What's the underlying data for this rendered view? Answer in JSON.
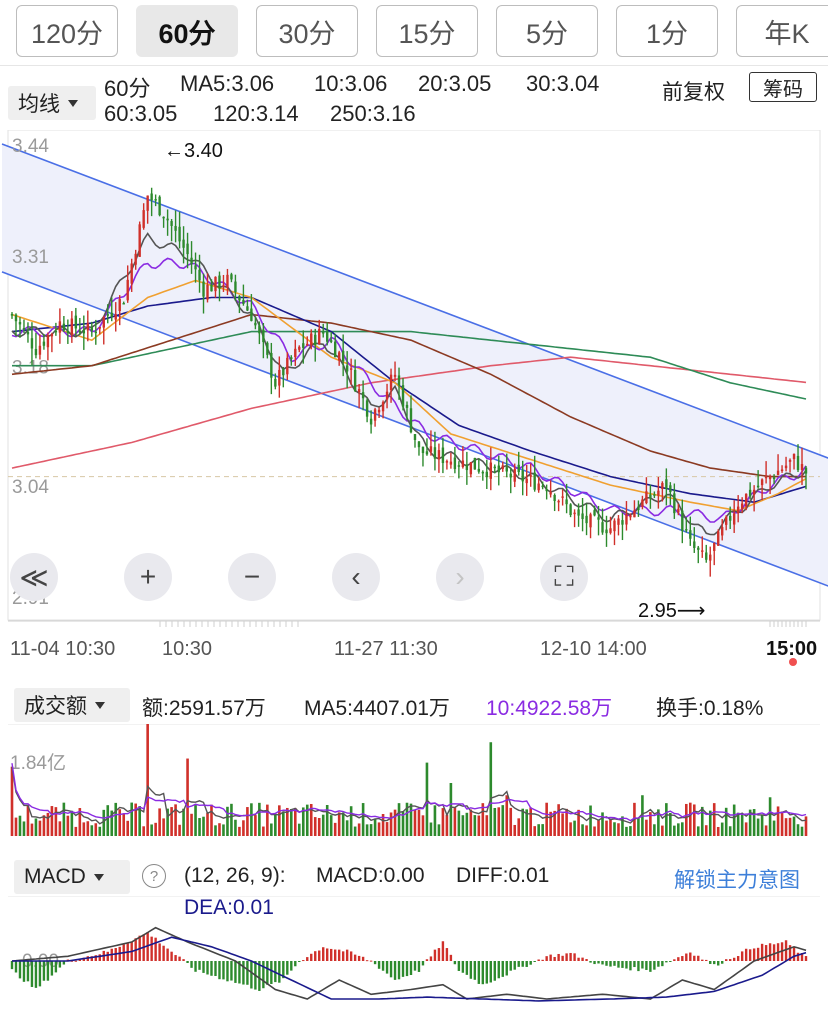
{
  "tabs": [
    "120分",
    "60分",
    "30分",
    "15分",
    "5分",
    "1分",
    "年K"
  ],
  "active_tab": 1,
  "ma_header": {
    "selector": "均线",
    "period": "60分",
    "ma5": "MA5:3.06",
    "ma10": "10:3.06",
    "ma20": "20:3.05",
    "ma30": "30:3.04",
    "ma60": "60:3.05",
    "ma120": "120:3.14",
    "ma250": "250:3.16",
    "adjust": "前复权",
    "chips": "筹码"
  },
  "colors": {
    "up": "#d0302a",
    "down": "#2d8a2d",
    "ma5": "#555555",
    "ma10": "#8a2be2",
    "ma20": "#f0a030",
    "ma30": "#1a1a8c",
    "ma60": "#8b3a22",
    "ma120": "#2e8b57",
    "ma250": "#e05a6a",
    "channel": "#4a6fe6",
    "channel_fill": "#eef0fb",
    "link": "#3d7fd9"
  },
  "controls": [
    {
      "icon": "rewind-icon",
      "symbol": "≪",
      "dim": false
    },
    {
      "icon": "zoom-in-icon",
      "symbol": "+",
      "dim": false
    },
    {
      "icon": "zoom-out-icon",
      "symbol": "−",
      "dim": false
    },
    {
      "icon": "prev-icon",
      "symbol": "‹",
      "dim": false
    },
    {
      "icon": "next-icon",
      "symbol": "›",
      "dim": true
    },
    {
      "icon": "fullscreen-icon",
      "symbol": "⛶",
      "dim": false
    }
  ],
  "volume_header": {
    "selector": "成交额",
    "amount": "额:2591.57万",
    "ma5": "MA5:4407.01万",
    "ma10": "10:4922.58万",
    "turnover": "换手:0.18%"
  },
  "macd_header": {
    "selector": "MACD",
    "help": "?",
    "params": "(12, 26, 9):",
    "macd": "MACD:0.00",
    "diff": "DIFF:0.01",
    "dea": "DEA:0.01",
    "unlock": "解锁主力意图"
  },
  "chart_data": [
    {
      "type": "candlestick",
      "ylim": [
        2.91,
        3.44
      ],
      "y_ticks": [
        "3.44",
        "3.31",
        "3.18",
        "3.04",
        "2.91"
      ],
      "x_ticks": [
        "11-04 10:30",
        "10:30",
        "11-27 11:30",
        "12-10 14:00",
        "15:00"
      ],
      "annotations": {
        "high": "←3.40",
        "low": "2.95⟶"
      },
      "last_price": 3.05,
      "close_anchors": [
        [
          0,
          3.24
        ],
        [
          6,
          3.2
        ],
        [
          12,
          3.23
        ],
        [
          20,
          3.22
        ],
        [
          28,
          3.26
        ],
        [
          34,
          3.38
        ],
        [
          38,
          3.36
        ],
        [
          44,
          3.31
        ],
        [
          48,
          3.27
        ],
        [
          54,
          3.28
        ],
        [
          60,
          3.24
        ],
        [
          66,
          3.16
        ],
        [
          72,
          3.2
        ],
        [
          78,
          3.22
        ],
        [
          84,
          3.18
        ],
        [
          90,
          3.12
        ],
        [
          96,
          3.17
        ],
        [
          102,
          3.08
        ],
        [
          110,
          3.07
        ],
        [
          118,
          3.06
        ],
        [
          126,
          3.05
        ],
        [
          134,
          3.04
        ],
        [
          142,
          3.0
        ],
        [
          150,
          2.99
        ],
        [
          158,
          3.02
        ],
        [
          164,
          3.04
        ],
        [
          170,
          2.97
        ],
        [
          174,
          2.95
        ],
        [
          182,
          3.02
        ],
        [
          190,
          3.05
        ],
        [
          196,
          3.07
        ],
        [
          200,
          3.05
        ]
      ],
      "ma_anchors": {
        "ma5": [
          [
            0,
            3.22
          ],
          [
            20,
            3.22
          ],
          [
            34,
            3.33
          ],
          [
            44,
            3.31
          ],
          [
            60,
            3.24
          ],
          [
            68,
            3.17
          ],
          [
            78,
            3.21
          ],
          [
            90,
            3.13
          ],
          [
            96,
            3.15
          ],
          [
            104,
            3.08
          ],
          [
            130,
            3.05
          ],
          [
            150,
            3.0
          ],
          [
            164,
            3.03
          ],
          [
            174,
            2.98
          ],
          [
            190,
            3.04
          ],
          [
            200,
            3.06
          ]
        ],
        "ma10": [
          [
            0,
            3.22
          ],
          [
            20,
            3.22
          ],
          [
            34,
            3.3
          ],
          [
            44,
            3.3
          ],
          [
            60,
            3.25
          ],
          [
            70,
            3.19
          ],
          [
            80,
            3.21
          ],
          [
            92,
            3.15
          ],
          [
            104,
            3.1
          ],
          [
            130,
            3.06
          ],
          [
            150,
            3.01
          ],
          [
            166,
            3.01
          ],
          [
            178,
            3.0
          ],
          [
            190,
            3.04
          ],
          [
            200,
            3.06
          ]
        ],
        "ma20": [
          [
            0,
            3.24
          ],
          [
            20,
            3.21
          ],
          [
            34,
            3.26
          ],
          [
            46,
            3.28
          ],
          [
            60,
            3.26
          ],
          [
            80,
            3.19
          ],
          [
            96,
            3.16
          ],
          [
            110,
            3.1
          ],
          [
            130,
            3.07
          ],
          [
            150,
            3.04
          ],
          [
            170,
            3.02
          ],
          [
            182,
            3.01
          ],
          [
            192,
            3.03
          ],
          [
            200,
            3.05
          ]
        ],
        "ma30": [
          [
            0,
            3.22
          ],
          [
            20,
            3.23
          ],
          [
            34,
            3.25
          ],
          [
            50,
            3.26
          ],
          [
            60,
            3.26
          ],
          [
            80,
            3.22
          ],
          [
            96,
            3.16
          ],
          [
            112,
            3.11
          ],
          [
            130,
            3.08
          ],
          [
            150,
            3.05
          ],
          [
            170,
            3.03
          ],
          [
            186,
            3.02
          ],
          [
            200,
            3.04
          ]
        ],
        "ma60": [
          [
            0,
            3.17
          ],
          [
            20,
            3.18
          ],
          [
            40,
            3.21
          ],
          [
            60,
            3.24
          ],
          [
            80,
            3.23
          ],
          [
            100,
            3.21
          ],
          [
            120,
            3.17
          ],
          [
            140,
            3.12
          ],
          [
            160,
            3.08
          ],
          [
            175,
            3.06
          ],
          [
            190,
            3.05
          ],
          [
            200,
            3.05
          ]
        ],
        "ma120": [
          [
            0,
            3.18
          ],
          [
            20,
            3.18
          ],
          [
            40,
            3.2
          ],
          [
            60,
            3.22
          ],
          [
            80,
            3.22
          ],
          [
            100,
            3.22
          ],
          [
            120,
            3.21
          ],
          [
            140,
            3.2
          ],
          [
            160,
            3.19
          ],
          [
            180,
            3.16
          ],
          [
            200,
            3.14
          ]
        ],
        "ma250": [
          [
            0,
            3.06
          ],
          [
            30,
            3.09
          ],
          [
            60,
            3.13
          ],
          [
            90,
            3.16
          ],
          [
            120,
            3.18
          ],
          [
            140,
            3.19
          ],
          [
            160,
            3.18
          ],
          [
            180,
            3.17
          ],
          [
            200,
            3.16
          ]
        ]
      },
      "channel": {
        "upper": [
          [
            0,
            3.44
          ],
          [
            200,
            3.07
          ]
        ],
        "lower": [
          [
            0,
            3.29
          ],
          [
            200,
            2.92
          ]
        ]
      }
    },
    {
      "type": "bar",
      "name": "成交额",
      "y_tick": "1.84亿",
      "ylim": [
        0,
        2.6
      ],
      "y_tick_value": 1.84,
      "base_level": 0.55,
      "spikes": [
        [
          0,
          1.7
        ],
        [
          34,
          3.5
        ],
        [
          44,
          1.9
        ],
        [
          104,
          1.8
        ],
        [
          110,
          1.3
        ],
        [
          120,
          2.3
        ],
        [
          124,
          1.0
        ],
        [
          158,
          1.0
        ],
        [
          190,
          0.95
        ]
      ],
      "ma5_level": 0.75,
      "ma10_level": 0.85
    },
    {
      "type": "bar",
      "name": "MACD",
      "ylim": [
        -0.06,
        0.06
      ],
      "y_tick": "0.00",
      "hist_anchors": [
        [
          0,
          -0.01
        ],
        [
          6,
          -0.03
        ],
        [
          14,
          0.0
        ],
        [
          24,
          0.01
        ],
        [
          34,
          0.03
        ],
        [
          40,
          0.01
        ],
        [
          46,
          -0.01
        ],
        [
          54,
          -0.02
        ],
        [
          62,
          -0.03
        ],
        [
          68,
          -0.02
        ],
        [
          72,
          0.0
        ],
        [
          78,
          0.015
        ],
        [
          84,
          0.01
        ],
        [
          90,
          0.0
        ],
        [
          96,
          -0.02
        ],
        [
          102,
          -0.01
        ],
        [
          108,
          0.02
        ],
        [
          112,
          -0.01
        ],
        [
          118,
          -0.025
        ],
        [
          126,
          -0.01
        ],
        [
          134,
          0.005
        ],
        [
          140,
          0.008
        ],
        [
          148,
          -0.005
        ],
        [
          160,
          -0.01
        ],
        [
          170,
          0.01
        ],
        [
          176,
          -0.005
        ],
        [
          186,
          0.015
        ],
        [
          194,
          0.02
        ],
        [
          200,
          0.0
        ]
      ],
      "diff_anchors": [
        [
          0,
          0.0
        ],
        [
          14,
          0.005
        ],
        [
          30,
          0.02
        ],
        [
          36,
          0.035
        ],
        [
          44,
          0.02
        ],
        [
          56,
          0.0
        ],
        [
          66,
          -0.03
        ],
        [
          74,
          -0.04
        ],
        [
          82,
          -0.02
        ],
        [
          90,
          -0.035
        ],
        [
          100,
          -0.03
        ],
        [
          108,
          -0.025
        ],
        [
          114,
          -0.04
        ],
        [
          124,
          -0.035
        ],
        [
          134,
          -0.04
        ],
        [
          148,
          -0.035
        ],
        [
          160,
          -0.04
        ],
        [
          168,
          -0.02
        ],
        [
          176,
          -0.03
        ],
        [
          186,
          0.0
        ],
        [
          196,
          0.015
        ],
        [
          200,
          0.01
        ]
      ],
      "dea_anchors": [
        [
          0,
          0.0
        ],
        [
          14,
          0.0
        ],
        [
          30,
          0.01
        ],
        [
          40,
          0.025
        ],
        [
          50,
          0.015
        ],
        [
          60,
          0.0
        ],
        [
          70,
          -0.02
        ],
        [
          80,
          -0.04
        ],
        [
          92,
          -0.04
        ],
        [
          104,
          -0.038
        ],
        [
          118,
          -0.04
        ],
        [
          132,
          -0.042
        ],
        [
          150,
          -0.04
        ],
        [
          164,
          -0.038
        ],
        [
          176,
          -0.032
        ],
        [
          188,
          -0.015
        ],
        [
          196,
          0.005
        ],
        [
          200,
          0.01
        ]
      ]
    }
  ]
}
